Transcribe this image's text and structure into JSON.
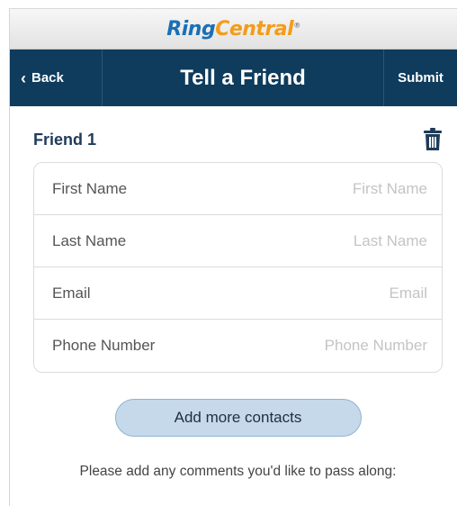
{
  "brand": {
    "logo_part1": "Ring",
    "logo_part2": "Central",
    "logo_mark": "®"
  },
  "nav": {
    "back_label": "Back",
    "title": "Tell a Friend",
    "submit_label": "Submit"
  },
  "friend": {
    "title": "Friend 1",
    "delete_icon": "trash-icon",
    "fields": [
      {
        "label": "First Name",
        "placeholder": "First Name",
        "value": ""
      },
      {
        "label": "Last Name",
        "placeholder": "Last Name",
        "value": ""
      },
      {
        "label": "Email",
        "placeholder": "Email",
        "value": ""
      },
      {
        "label": "Phone Number",
        "placeholder": "Phone Number",
        "value": ""
      }
    ]
  },
  "add_contacts_label": "Add more contacts",
  "comments_prompt": "Please add any comments you'd like to pass along:",
  "colors": {
    "nav_bg": "#0f3b5c",
    "logo_blue": "#1a6fb5",
    "logo_orange": "#f39c19",
    "add_btn_bg": "#c6d9ea"
  }
}
